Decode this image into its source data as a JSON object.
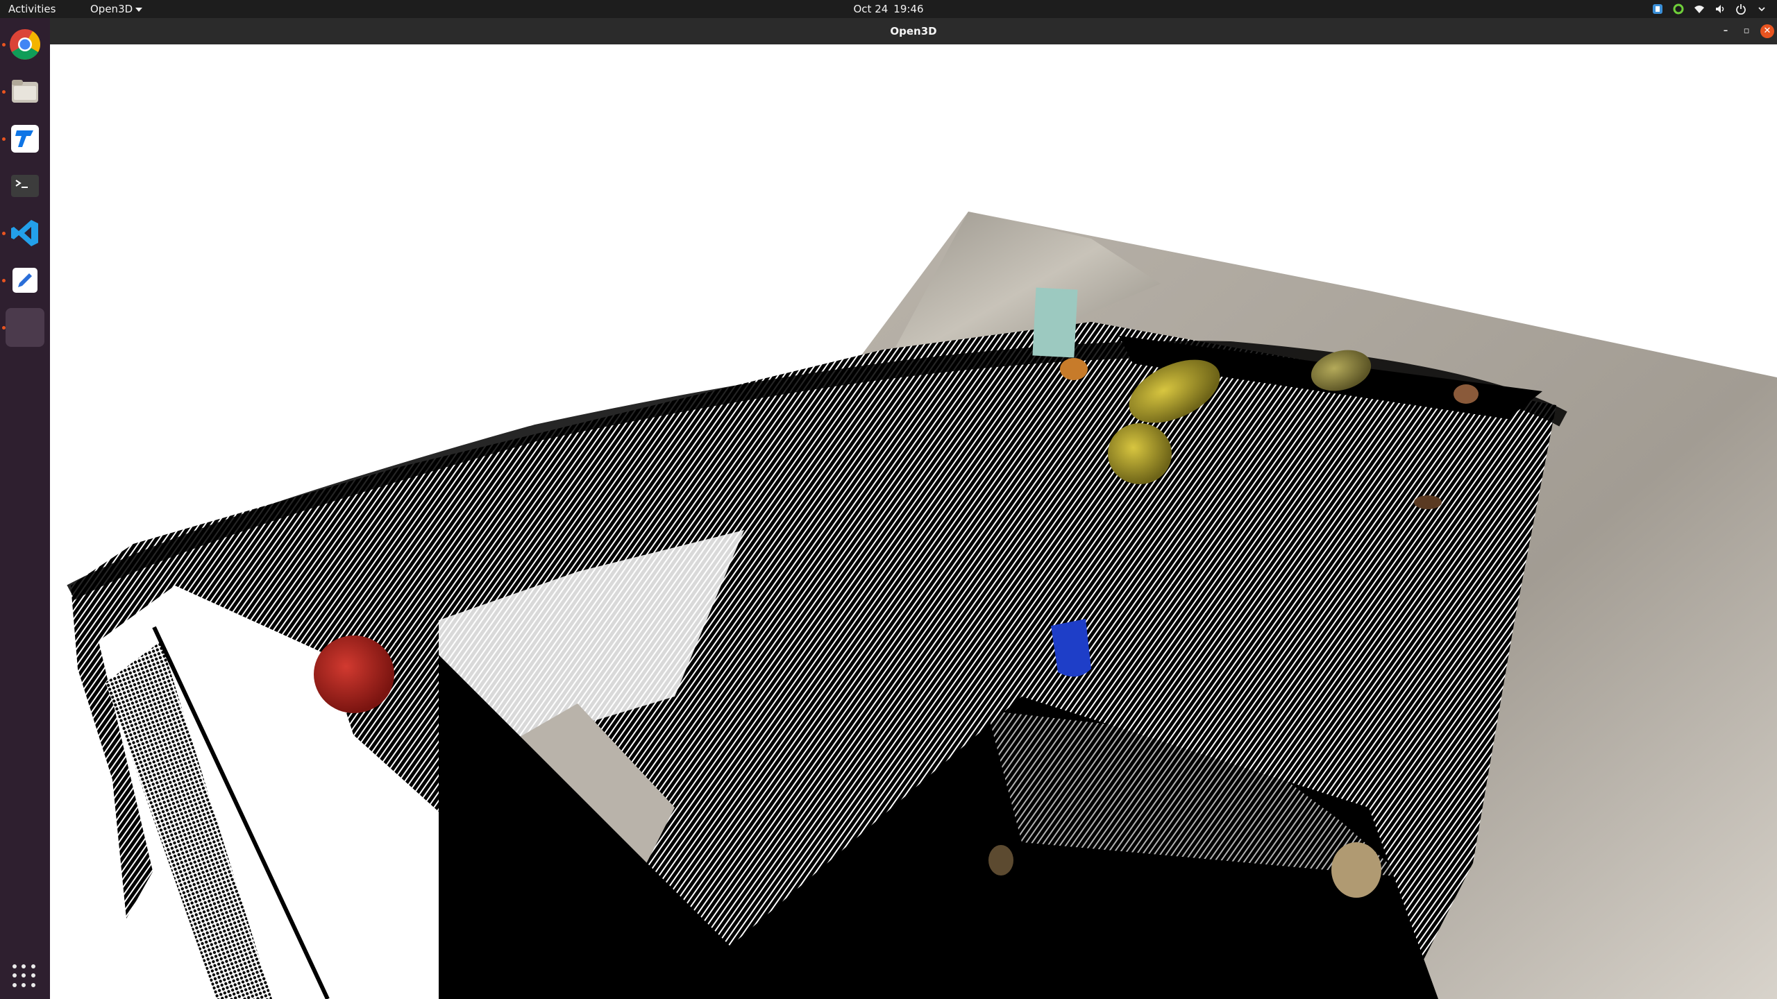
{
  "topbar": {
    "activities": "Activities",
    "app_menu": "Open3D",
    "date": "Oct 24",
    "time": "19:46"
  },
  "dock": {
    "apps": [
      {
        "name": "chrome-icon"
      },
      {
        "name": "files-icon"
      },
      {
        "name": "remote-desktop-icon"
      },
      {
        "name": "terminal-icon"
      },
      {
        "name": "vscode-icon"
      },
      {
        "name": "text-editor-icon"
      },
      {
        "name": "open3d-window-icon"
      }
    ]
  },
  "window": {
    "title": "Open3D"
  },
  "colors": {
    "topbar": "#1d1d1d",
    "dock": "#2e1f2f",
    "accent": "#e95420",
    "viewport_bg": "#ffffff"
  }
}
